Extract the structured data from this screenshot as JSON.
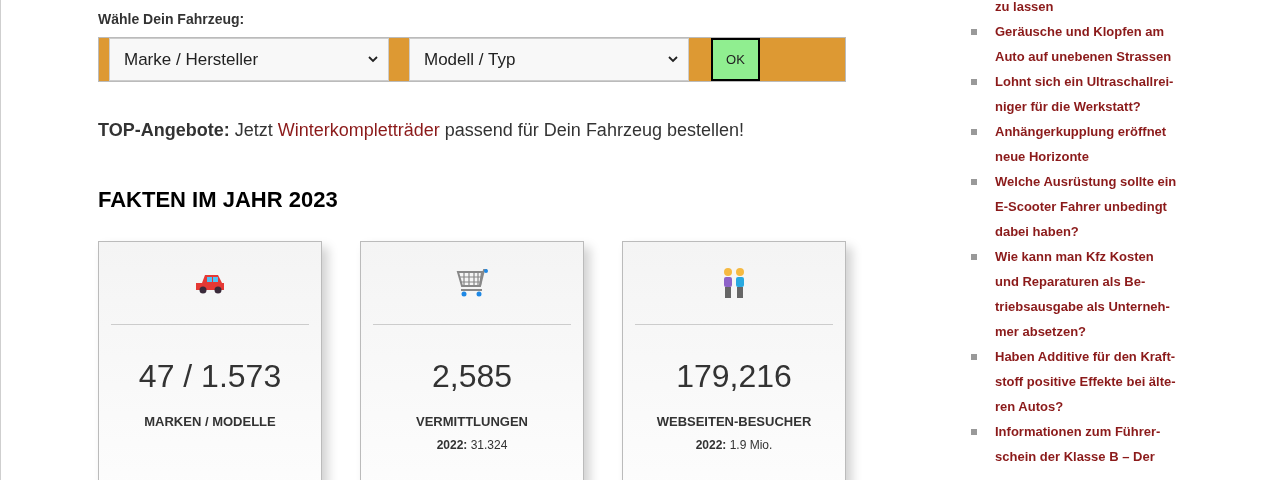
{
  "vehicle_picker": {
    "label": "Wähle Dein Fahrzeug:",
    "selects": [
      {
        "value": "Marke / Hersteller"
      },
      {
        "value": "Modell / Typ"
      }
    ],
    "button": "OK"
  },
  "offer": {
    "lead": "TOP-Angebote:",
    "before": "Jetzt",
    "link": "Winterkompletträder",
    "after": "passend für Dein Fahrzeug bestellen!"
  },
  "facts": {
    "heading": "FAKTEN IM JAHR 2023",
    "cards": [
      {
        "kind": "car",
        "number": "47 / 1.573",
        "label": "MARKEN / MODELLE"
      },
      {
        "kind": "cart",
        "number": "2,585",
        "label": "VERMITTLUNGEN",
        "previous": "**2022:** 31.324"
      },
      {
        "kind": "people",
        "number": "179,216",
        "label": "WEBSEITEN-BESUCHER",
        "previous": "**2022:** 1.9 Mio."
      }
    ]
  },
  "sidebar": {
    "items": [
      {
        "bullet": false,
        "lines": [
          "zu lassen"
        ]
      },
      {
        "bullet": true,
        "lines": [
          "Geräusche und Klopfen am",
          "Auto auf unebenen Strassen"
        ]
      },
      {
        "bullet": true,
        "lines": [
          "Lohnt sich ein Ultraschallrei-",
          "niger für die Werkstatt?"
        ]
      },
      {
        "bullet": true,
        "lines": [
          "Anhängerkupplung eröffnet",
          "neue Horizonte"
        ]
      },
      {
        "bullet": true,
        "lines": [
          "Welche Ausrüstung sollte ein",
          "E-Scooter Fahrer unbedingt",
          "dabei haben?"
        ]
      },
      {
        "bullet": true,
        "lines": [
          "Wie kann man Kfz Kosten",
          "und Reparaturen als Be-",
          "triebsausgabe als Unterneh-",
          "mer absetzen?"
        ]
      },
      {
        "bullet": true,
        "lines": [
          "Haben Additive für den Kraft-",
          "stoff positive Effekte bei älte-",
          "ren Autos?"
        ]
      },
      {
        "bullet": true,
        "lines": [
          "Informationen zum Führer-",
          "schein der Klasse B – Der"
        ]
      }
    ]
  }
}
